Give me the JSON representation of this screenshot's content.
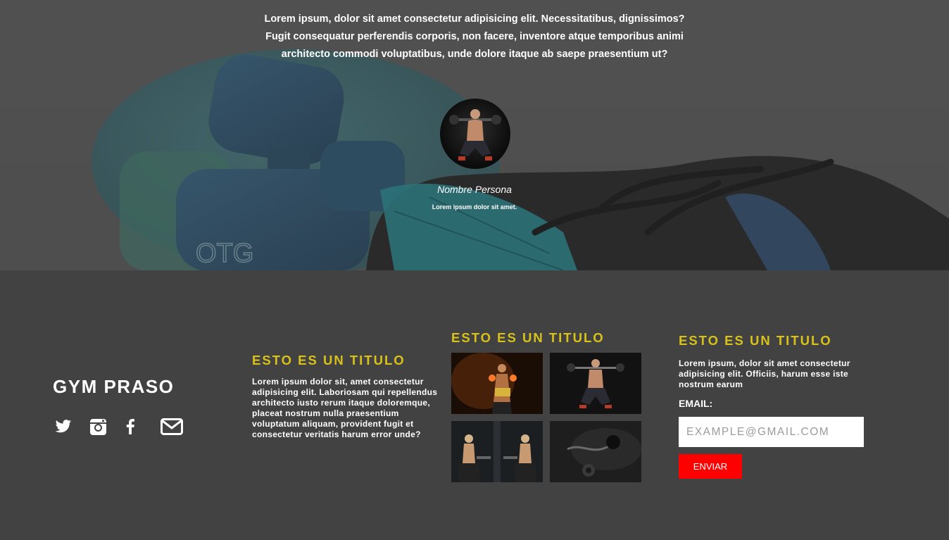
{
  "hero": {
    "quote": "Lorem ipsum, dolor sit amet consectetur adipisicing elit. Necessitatibus, dignissimos? Fugit consequatur perferendis corporis, non facere, inventore atque temporibus animi architecto commodi voluptatibus, unde dolore itaque ab saepe praesentium ut?",
    "person_name": "Nombre Persona",
    "person_role": "Lorem ipsum dolor sit amet."
  },
  "footer": {
    "brand": "GYM PRASO",
    "socials": [
      {
        "icon": "twitter-icon"
      },
      {
        "icon": "instagram-icon"
      },
      {
        "icon": "facebook-icon"
      },
      {
        "icon": "mail-icon"
      }
    ],
    "col1": {
      "title": "ESTO ES UN TITULO",
      "text": "Lorem ipsum dolor sit, amet consectetur adipisicing elit. Laboriosam qui repellendus architecto iusto rerum itaque doloremque, placeat nostrum nulla praesentium voluptatum aliquam, provident fugit et consectetur veritatis harum error unde?"
    },
    "col2": {
      "title": "ESTO ES UN TITULO"
    },
    "col3": {
      "title": "ESTO ES UN TITULO",
      "text": "Lorem ipsum, dolor sit amet consectetur adipisicing elit. Officiis, harum esse iste nostrum earum",
      "email_label": "EMAIL:",
      "email_placeholder": "EXAMPLE@GMAIL.COM",
      "send_label": "ENVIAR"
    },
    "colors": {
      "title": "#d8c21a",
      "button": "#ff0000",
      "background": "#424242"
    }
  }
}
